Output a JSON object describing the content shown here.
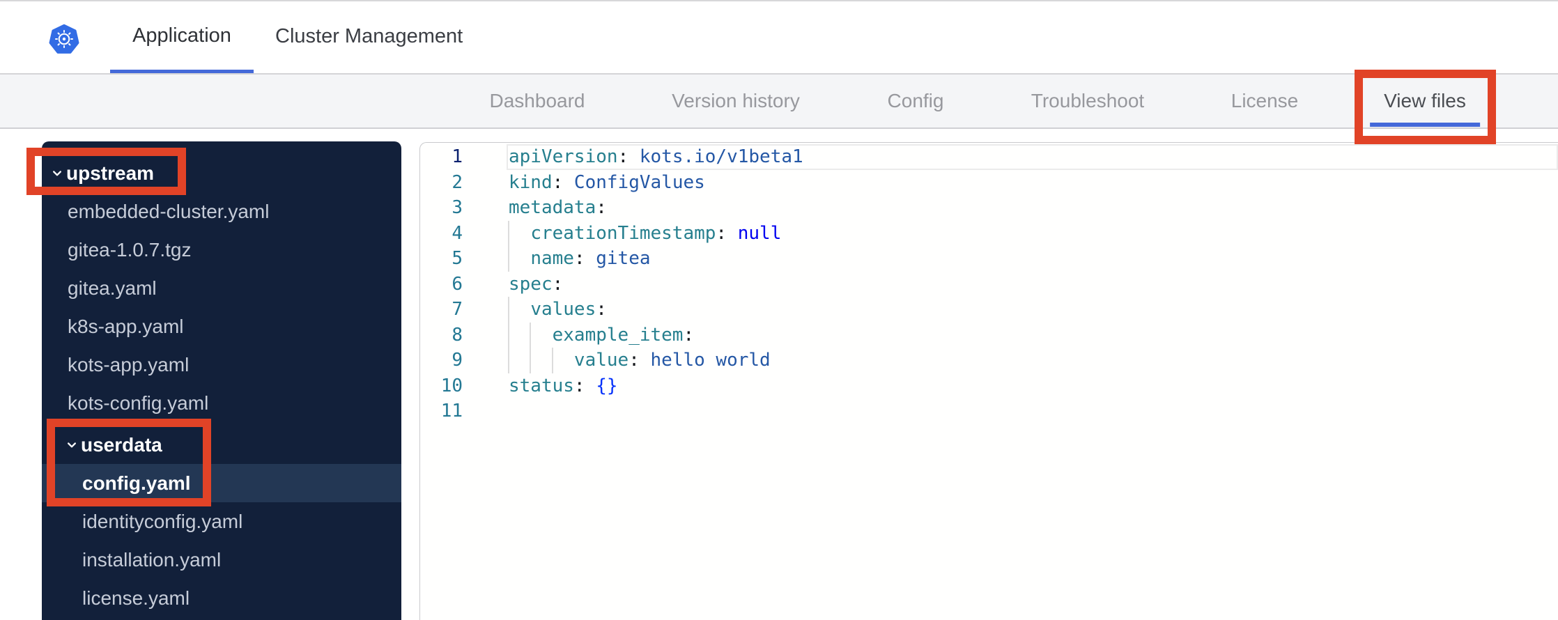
{
  "topbar": {
    "logo_icon": "kubernetes-logo",
    "tabs": [
      {
        "label": "Application",
        "active": true
      },
      {
        "label": "Cluster Management",
        "active": false
      }
    ]
  },
  "subnav": {
    "tabs": [
      {
        "label": "Dashboard"
      },
      {
        "label": "Version history"
      },
      {
        "label": "Config"
      },
      {
        "label": "Troubleshoot"
      },
      {
        "label": "License"
      },
      {
        "label": "View files"
      }
    ],
    "active_tab": "View files"
  },
  "sidebar": {
    "items": [
      {
        "label": "upstream",
        "type": "folder",
        "depth": 0,
        "expanded": true,
        "selected": false
      },
      {
        "label": "embedded-cluster.yaml",
        "type": "file",
        "depth": 1,
        "selected": false
      },
      {
        "label": "gitea-1.0.7.tgz",
        "type": "file",
        "depth": 1,
        "selected": false
      },
      {
        "label": "gitea.yaml",
        "type": "file",
        "depth": 1,
        "selected": false
      },
      {
        "label": "k8s-app.yaml",
        "type": "file",
        "depth": 1,
        "selected": false
      },
      {
        "label": "kots-app.yaml",
        "type": "file",
        "depth": 1,
        "selected": false
      },
      {
        "label": "kots-config.yaml",
        "type": "file",
        "depth": 1,
        "selected": false
      },
      {
        "label": "userdata",
        "type": "folder",
        "depth": 1,
        "expanded": true,
        "selected": false
      },
      {
        "label": "config.yaml",
        "type": "file",
        "depth": 2,
        "selected": true
      },
      {
        "label": "identityconfig.yaml",
        "type": "file",
        "depth": 2,
        "selected": false
      },
      {
        "label": "installation.yaml",
        "type": "file",
        "depth": 2,
        "selected": false
      },
      {
        "label": "license.yaml",
        "type": "file",
        "depth": 2,
        "selected": false
      }
    ]
  },
  "editor": {
    "language": "yaml",
    "lines": [
      {
        "number": 1,
        "active": true,
        "indent": 0,
        "tokens": [
          [
            "key",
            "apiVersion"
          ],
          [
            "colon",
            ":"
          ],
          [
            "value",
            " kots.io/v1beta1"
          ]
        ]
      },
      {
        "number": 2,
        "active": false,
        "indent": 0,
        "tokens": [
          [
            "key",
            "kind"
          ],
          [
            "colon",
            ":"
          ],
          [
            "value",
            " ConfigValues"
          ]
        ]
      },
      {
        "number": 3,
        "active": false,
        "indent": 0,
        "tokens": [
          [
            "key",
            "metadata"
          ],
          [
            "colon",
            ":"
          ]
        ]
      },
      {
        "number": 4,
        "active": false,
        "indent": 2,
        "tokens": [
          [
            "key",
            "creationTimestamp"
          ],
          [
            "colon",
            ":"
          ],
          [
            "keyword",
            " null"
          ]
        ]
      },
      {
        "number": 5,
        "active": false,
        "indent": 2,
        "tokens": [
          [
            "key",
            "name"
          ],
          [
            "colon",
            ":"
          ],
          [
            "value",
            " gitea"
          ]
        ]
      },
      {
        "number": 6,
        "active": false,
        "indent": 0,
        "tokens": [
          [
            "key",
            "spec"
          ],
          [
            "colon",
            ":"
          ]
        ]
      },
      {
        "number": 7,
        "active": false,
        "indent": 2,
        "tokens": [
          [
            "key",
            "values"
          ],
          [
            "colon",
            ":"
          ]
        ]
      },
      {
        "number": 8,
        "active": false,
        "indent": 4,
        "tokens": [
          [
            "key",
            "example_item"
          ],
          [
            "colon",
            ":"
          ]
        ]
      },
      {
        "number": 9,
        "active": false,
        "indent": 6,
        "tokens": [
          [
            "key",
            "value"
          ],
          [
            "colon",
            ":"
          ],
          [
            "value",
            " hello world"
          ]
        ]
      },
      {
        "number": 10,
        "active": false,
        "indent": 0,
        "tokens": [
          [
            "key",
            "status"
          ],
          [
            "colon",
            ":"
          ],
          [
            "bracket",
            " {}"
          ]
        ]
      },
      {
        "number": 11,
        "active": false,
        "indent": 0,
        "tokens": []
      }
    ]
  },
  "annotations": {
    "boxes": [
      "upstream-folder",
      "userdata-config-yaml",
      "view-files-tab"
    ]
  },
  "colors": {
    "accent": "#4469d9",
    "logo_blue": "#326ce5",
    "annotation_red": "#e14327",
    "sidebar_bg": "#12203a",
    "sidebar_selected_bg": "#233754",
    "sidebar_file_text": "#c6ccd8",
    "token_key": "#267f8e",
    "token_value": "#2457a5",
    "token_keyword": "#0000f0",
    "token_bracket": "#0431fa",
    "token_colon": "#16181c",
    "line_number": "#237893",
    "line_number_active": "#0b216f"
  }
}
